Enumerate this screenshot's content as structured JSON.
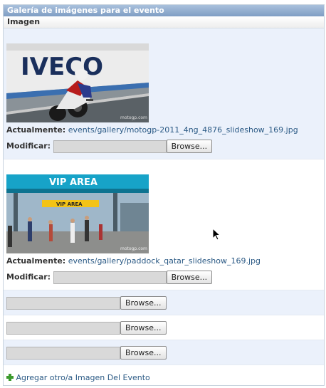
{
  "group_title": "Galería de imágenes para el evento",
  "column_header": "Imagen",
  "current_label": "Actualmente:",
  "modify_label": "Modificar:",
  "browse_label": "Browse...",
  "images": [
    {
      "current_file": "events/gallery/motogp-2011_4ng_4876_slideshow_169.jpg",
      "thumb_text_1": "IVECO",
      "thumb_text_2": "motogp.com"
    },
    {
      "current_file": "events/gallery/paddock_qatar_slideshow_169.jpg",
      "thumb_text_1": "VIP AREA",
      "thumb_text_2": "VIP AREA",
      "thumb_text_3": "motogp.com"
    }
  ],
  "extra_uploads": 3,
  "add_another": "Agregar otro/a Imagen Del Evento",
  "colors": {
    "header": "#7f9ec4",
    "row_alt": "#ebf1fb",
    "link": "#2b5a85",
    "add_icon": "#3c9a2e"
  }
}
